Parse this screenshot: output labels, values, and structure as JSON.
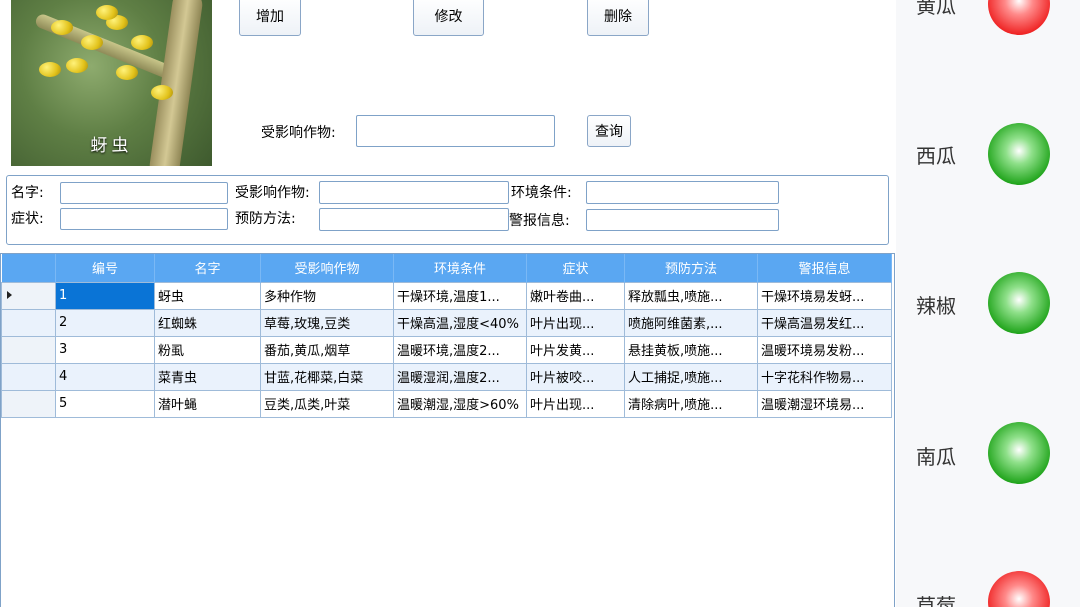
{
  "toolbar": {
    "add_label": "增加",
    "edit_label": "修改",
    "delete_label": "删除"
  },
  "photo": {
    "caption": "蚜虫"
  },
  "query": {
    "crop_label": "受影响作物:",
    "crop_value": "",
    "query_button": "查询"
  },
  "filters": {
    "name_label": "名字:",
    "affected_label": "受影响作物:",
    "env_label": "环境条件:",
    "symptom_label": "症状:",
    "prevention_label": "预防方法:",
    "alert_label": "警报信息:"
  },
  "table": {
    "columns": [
      "编号",
      "名字",
      "受影响作物",
      "环境条件",
      "症状",
      "预防方法",
      "警报信息"
    ],
    "rows": [
      [
        "1",
        "蚜虫",
        "多种作物",
        "干燥环境,温度1...",
        "嫩叶卷曲...",
        "释放瓢虫,喷施...",
        "干燥环境易发蚜..."
      ],
      [
        "2",
        "红蜘蛛",
        "草莓,玫瑰,豆类",
        "干燥高温,湿度<40%",
        "叶片出现...",
        "喷施阿维菌素,...",
        "干燥高温易发红..."
      ],
      [
        "3",
        "粉虱",
        "番茄,黄瓜,烟草",
        "温暖环境,温度2...",
        "叶片发黄...",
        "悬挂黄板,喷施...",
        "温暖环境易发粉..."
      ],
      [
        "4",
        "菜青虫",
        "甘蓝,花椰菜,白菜",
        "温暖湿润,温度2...",
        "叶片被咬...",
        "人工捕捉,喷施...",
        "十字花科作物易..."
      ],
      [
        "5",
        "潜叶蝇",
        "豆类,瓜类,叶菜",
        "温暖潮湿,湿度>60%",
        "叶片出现...",
        "清除病叶,喷施...",
        "温暖潮湿环境易..."
      ]
    ]
  },
  "crops": [
    {
      "name": "黄瓜",
      "status": "red"
    },
    {
      "name": "西瓜",
      "status": "green"
    },
    {
      "name": "辣椒",
      "status": "green"
    },
    {
      "name": "南瓜",
      "status": "green"
    },
    {
      "name": "草莓",
      "status": "red"
    }
  ],
  "colors": {
    "header_blue": "#5aa7f2",
    "selection_blue": "#0a74d6",
    "lamp_red": "#ee1e1e",
    "lamp_green": "#22a51d"
  }
}
